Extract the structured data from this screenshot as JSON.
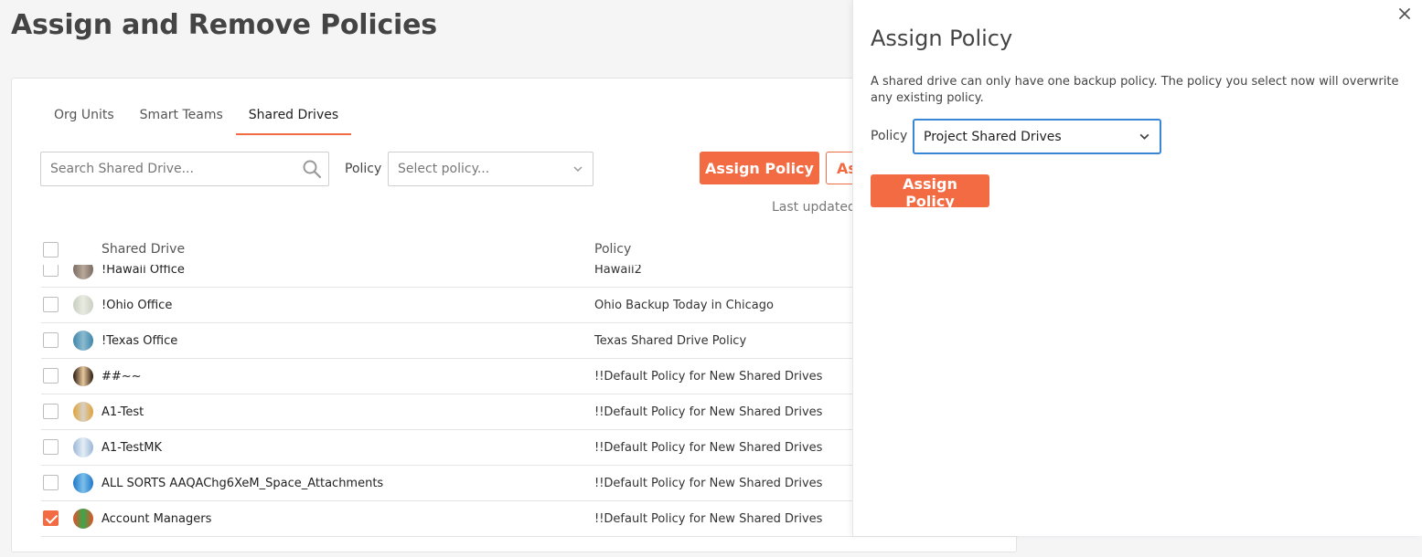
{
  "page": {
    "title": "Assign and Remove Policies"
  },
  "tabs": [
    {
      "label": "Org Units",
      "active": false
    },
    {
      "label": "Smart Teams",
      "active": false
    },
    {
      "label": "Shared Drives",
      "active": true
    }
  ],
  "toolbar": {
    "search_placeholder": "Search Shared Drive...",
    "policy_label": "Policy",
    "policy_placeholder": "Select policy...",
    "assign_label": "Assign Policy",
    "remove_label_partial": "As",
    "last_updated_partial": "Last updated"
  },
  "table": {
    "columns": {
      "drive": "Shared Drive",
      "policy": "Policy"
    },
    "rows": [
      {
        "name": "!Hawaii Office",
        "policy": "Hawaii2",
        "checked": false,
        "avatar_colors": [
          "#7a6c63",
          "#b9a89a"
        ]
      },
      {
        "name": "!Ohio Office",
        "policy": "Ohio Backup Today in Chicago",
        "checked": false,
        "avatar_colors": [
          "#c8cfc0",
          "#e8ebe2"
        ]
      },
      {
        "name": "!Texas Office",
        "policy": "Texas Shared Drive Policy",
        "checked": false,
        "avatar_colors": [
          "#3f86a8",
          "#8cbad0"
        ]
      },
      {
        "name": "##~~",
        "policy": "!!Default Policy for New Shared Drives",
        "checked": false,
        "avatar_colors": [
          "#2b1a0f",
          "#e6c79c"
        ]
      },
      {
        "name": "A1-Test",
        "policy": "!!Default Policy for New Shared Drives",
        "checked": false,
        "avatar_colors": [
          "#e0a23a",
          "#d8d0c4"
        ]
      },
      {
        "name": "A1-TestMK",
        "policy": "!!Default Policy for New Shared Drives",
        "checked": false,
        "avatar_colors": [
          "#9ab7d6",
          "#e4edf6"
        ]
      },
      {
        "name": "ALL SORTS AAQAChg6XeM_Space_Attachments",
        "policy": "!!Default Policy for New Shared Drives",
        "checked": false,
        "avatar_colors": [
          "#1f78c8",
          "#7cc0ec"
        ]
      },
      {
        "name": "Account Managers",
        "policy": "!!Default Policy for New Shared Drives",
        "checked": true,
        "avatar_colors": [
          "#e2502b",
          "#39a84a"
        ]
      }
    ]
  },
  "panel": {
    "title": "Assign Policy",
    "description": "A shared drive can only have one backup policy. The policy you select now will overwrite any existing policy.",
    "policy_label": "Policy",
    "selected_policy": "Project Shared Drives",
    "assign_label": "Assign Policy"
  },
  "colors": {
    "accent": "#f26b43",
    "focus": "#3a86d6"
  }
}
